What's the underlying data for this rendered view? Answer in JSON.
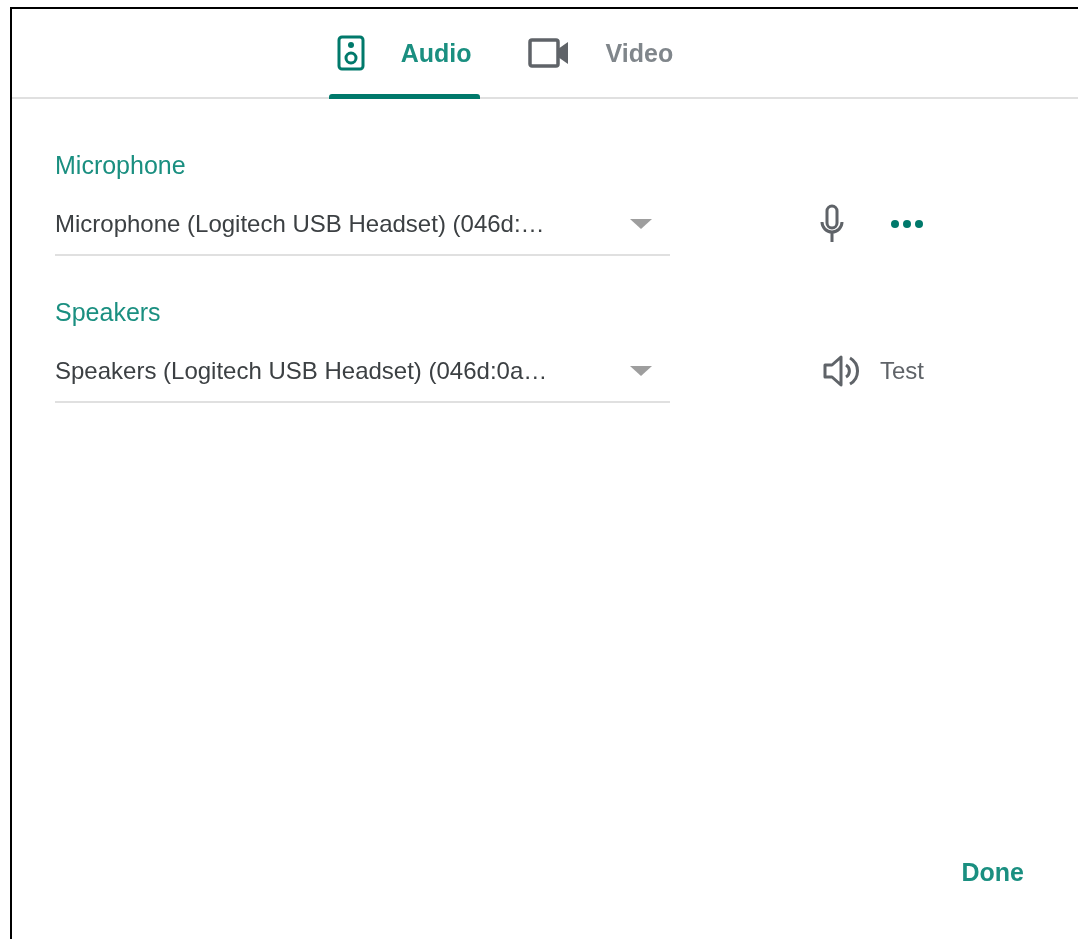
{
  "tabs": [
    {
      "kind": "audio",
      "label": "Audio",
      "selected": true
    },
    {
      "kind": "video",
      "label": "Video",
      "selected": false
    }
  ],
  "sections": [
    {
      "kind": "microphone",
      "label": "Microphone",
      "value": "Microphone (Logitech USB Headset) (046d:…"
    },
    {
      "kind": "speakers",
      "label": "Speakers",
      "value": "Speakers (Logitech USB Headset) (046d:0a…",
      "action": "Test"
    }
  ],
  "done_button": "Done"
}
